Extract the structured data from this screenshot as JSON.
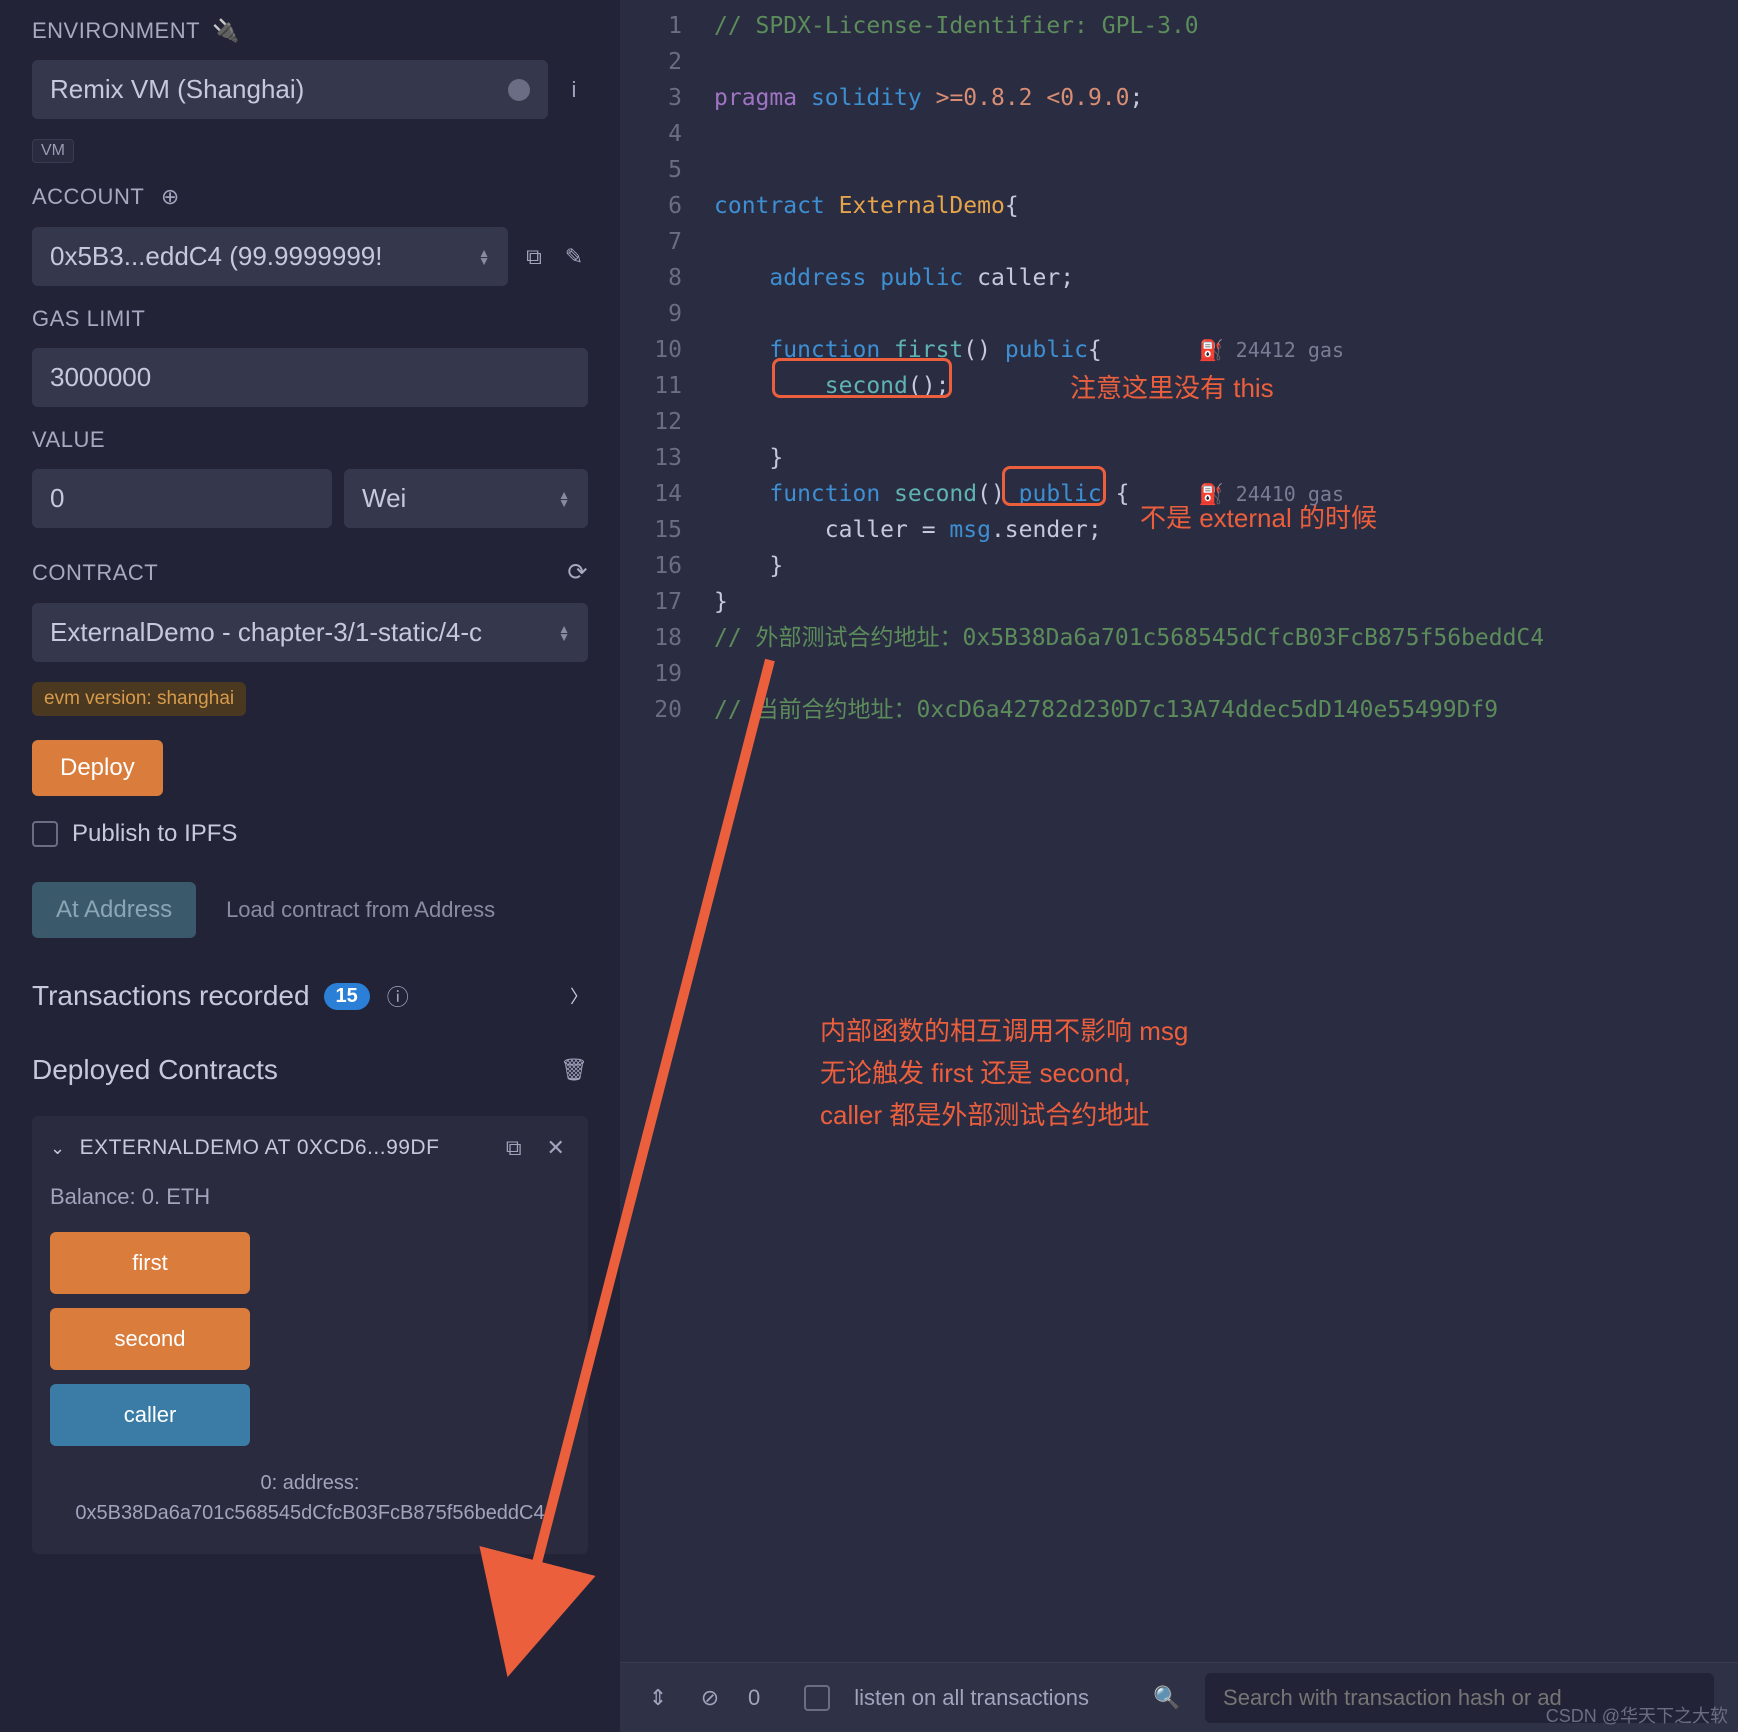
{
  "sidebar": {
    "env_label": "ENVIRONMENT",
    "env_value": "Remix VM (Shanghai)",
    "vm_badge": "VM",
    "account_label": "ACCOUNT",
    "account_value": "0x5B3...eddC4 (99.9999999!",
    "gas_label": "GAS LIMIT",
    "gas_value": "3000000",
    "value_label": "VALUE",
    "value_amount": "0",
    "value_unit": "Wei",
    "contract_label": "CONTRACT",
    "contract_value": "ExternalDemo - chapter-3/1-static/4-c",
    "evm_badge": "evm version: shanghai",
    "deploy_label": "Deploy",
    "publish_label": "Publish to IPFS",
    "ataddress_label": "At Address",
    "ataddress_placeholder": "Load contract from Address",
    "tx_recorded_label": "Transactions recorded",
    "tx_count": "15",
    "deployed_label": "Deployed Contracts",
    "deployed_item": "EXTERNALDEMO AT 0XCD6...99DF",
    "balance": "Balance: 0. ETH",
    "fn_first": "first",
    "fn_second": "second",
    "fn_caller": "caller",
    "result": "0:  address: 0x5B38Da6a701c568545dCfcB03FcB875f56beddC4"
  },
  "code": {
    "lines": [
      {
        "n": 1,
        "t": "// SPDX-License-Identifier: GPL-3.0",
        "cls": "cm2"
      },
      {
        "n": 2,
        "t": ""
      },
      {
        "n": 3,
        "html": "<span class='kw2'>pragma</span> <span class='kw'>solidity</span> <span class='op'>&gt;=</span><span class='num'>0.8.2</span> <span class='op'>&lt;</span><span class='num'>0.9.0</span>;"
      },
      {
        "n": 4,
        "t": ""
      },
      {
        "n": 5,
        "t": ""
      },
      {
        "n": 6,
        "html": "<span class='kw'>contract</span> <span class='ty'>ExternalDemo</span>{"
      },
      {
        "n": 7,
        "t": ""
      },
      {
        "n": 8,
        "html": "    <span class='kw'>address</span> <span class='kw'>public</span> caller;"
      },
      {
        "n": 9,
        "t": ""
      },
      {
        "n": 10,
        "html": "    <span class='kw'>function</span> <span class='fn'>first</span>() <span class='kw'>public</span>{       <span class='gas'>⛽ 24412 gas</span>"
      },
      {
        "n": 11,
        "html": "        <span class='fn'>second</span>();"
      },
      {
        "n": 12,
        "t": ""
      },
      {
        "n": 13,
        "t": "    }"
      },
      {
        "n": 14,
        "html": "    <span class='kw'>function</span> <span class='fn'>second</span>() <span class='kw'>public</span> {     <span class='gas'>⛽ 24410 gas</span>"
      },
      {
        "n": 15,
        "html": "        caller = <span class='kw'>msg</span>.sender;"
      },
      {
        "n": 16,
        "t": "    }"
      },
      {
        "n": 17,
        "t": "}"
      },
      {
        "n": 18,
        "html": "<span class='cm2'>// 外部测试合约地址：0x5B38Da6a701c568545dCfcB03FcB875f56beddC4</span>"
      },
      {
        "n": 19,
        "t": ""
      },
      {
        "n": 20,
        "html": "<span class='cm2'>// 当前合约地址：0xcD6a42782d230D7c13A74ddec5dD140e55499Df9</span>"
      }
    ]
  },
  "annotations": {
    "note1": "注意这里没有 this",
    "note2": "不是 external 的时候",
    "note3_l1": "内部函数的相互调用不影响 msg",
    "note3_l2": "无论触发 first 还是 second,",
    "note3_l3": "caller 都是外部测试合约地址"
  },
  "bottombar": {
    "count": "0",
    "listen": "listen on all transactions",
    "search_placeholder": "Search with transaction hash or ad"
  },
  "watermark": "CSDN @华天下之大软"
}
